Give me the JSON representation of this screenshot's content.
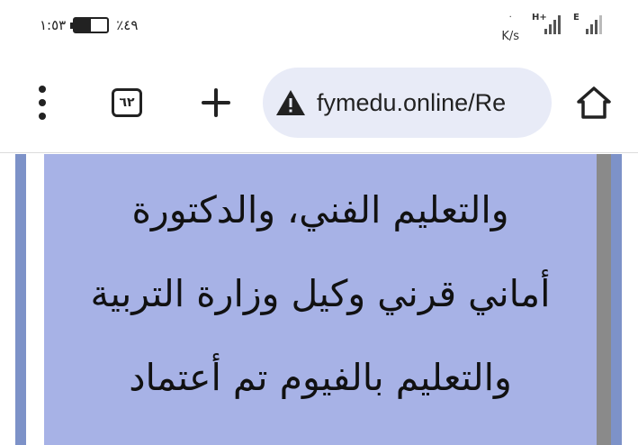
{
  "status_bar": {
    "time": "١:٥٣",
    "battery_percent": "٪٤٩",
    "battery_level": 0.49,
    "net_speed_unit": "K/s",
    "signal_1_type": "H+",
    "signal_2_type": "E"
  },
  "toolbar": {
    "url": "fymedu.online/Re",
    "tab_count": "٦٢",
    "icons": [
      "more-menu-icon",
      "tab-switcher-icon",
      "new-tab-icon",
      "warning-icon",
      "home-icon"
    ]
  },
  "article": {
    "lines": [
      "والتعليم الفني، والدكتورة",
      "أماني قرني وكيل وزارة التربية",
      "والتعليم بالفيوم تم أعتماد"
    ],
    "background_color": "#a7b2e6"
  }
}
